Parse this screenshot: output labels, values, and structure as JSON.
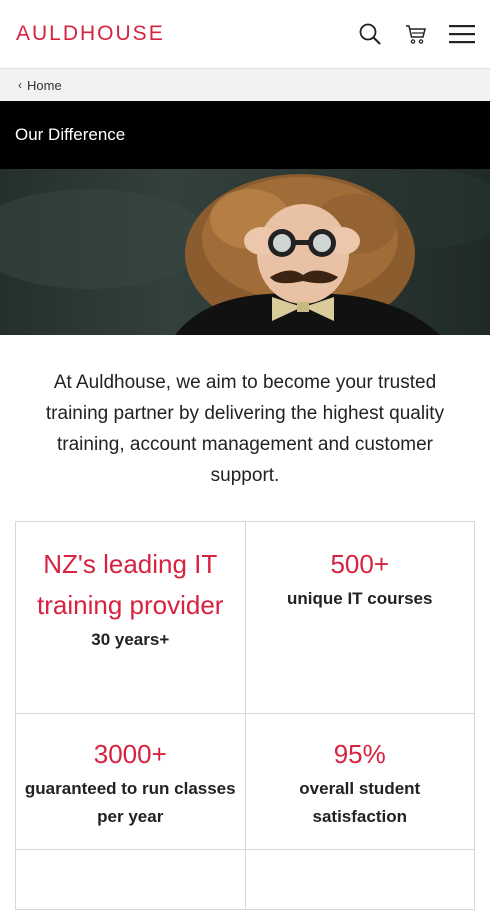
{
  "header": {
    "logo": "AULDHOUSE",
    "icons": [
      "search-icon",
      "cart-icon",
      "menu-icon"
    ]
  },
  "breadcrumb": {
    "home_label": "Home"
  },
  "page": {
    "title": "Our Difference"
  },
  "intro": {
    "text": "At Auldhouse, we aim to become your trusted training partner by delivering the highest quality training, account management and customer support."
  },
  "stats": [
    {
      "big": "NZ's leading IT training provider",
      "sub": "30 years+"
    },
    {
      "big": "500+",
      "sub": "unique IT courses"
    },
    {
      "big": "3000+",
      "sub": "guaranteed to run classes per year"
    },
    {
      "big": "95%",
      "sub": "overall student satisfaction"
    }
  ],
  "colors": {
    "brand": "#d6233f",
    "title_bar": "#000000",
    "breadcrumb_bg": "#f2f2f2"
  }
}
